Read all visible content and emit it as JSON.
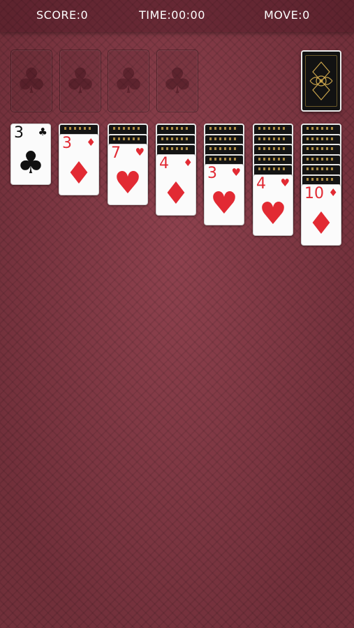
{
  "header": {
    "score_text": "SCORE:0",
    "time_text": "TIME:00:00",
    "move_text": "MOVE:0"
  },
  "foundations": [
    {
      "suit_icon": "club",
      "glyph": "♣"
    },
    {
      "suit_icon": "club",
      "glyph": "♣"
    },
    {
      "suit_icon": "club",
      "glyph": "♣"
    },
    {
      "suit_icon": "club",
      "glyph": "♣"
    }
  ],
  "stock": {
    "state": "face-down",
    "back_style": "black-gold-ornament"
  },
  "tableau": [
    {
      "hidden_count": 0,
      "top": {
        "rank": "3",
        "suit": "♣",
        "color": "black"
      }
    },
    {
      "hidden_count": 1,
      "top": {
        "rank": "3",
        "suit": "♦",
        "color": "red"
      }
    },
    {
      "hidden_count": 2,
      "top": {
        "rank": "7",
        "suit": "♥",
        "color": "red"
      }
    },
    {
      "hidden_count": 3,
      "top": {
        "rank": "4",
        "suit": "♦",
        "color": "red"
      }
    },
    {
      "hidden_count": 4,
      "top": {
        "rank": "3",
        "suit": "♥",
        "color": "red"
      }
    },
    {
      "hidden_count": 5,
      "top": {
        "rank": "4",
        "suit": "♥",
        "color": "red"
      }
    },
    {
      "hidden_count": 6,
      "top": {
        "rank": "10",
        "suit": "♦",
        "color": "red"
      }
    }
  ],
  "colors": {
    "table": "#8a3a47",
    "red_suit": "#e22a33",
    "black_suit": "#111111",
    "card_back": "#141414"
  }
}
